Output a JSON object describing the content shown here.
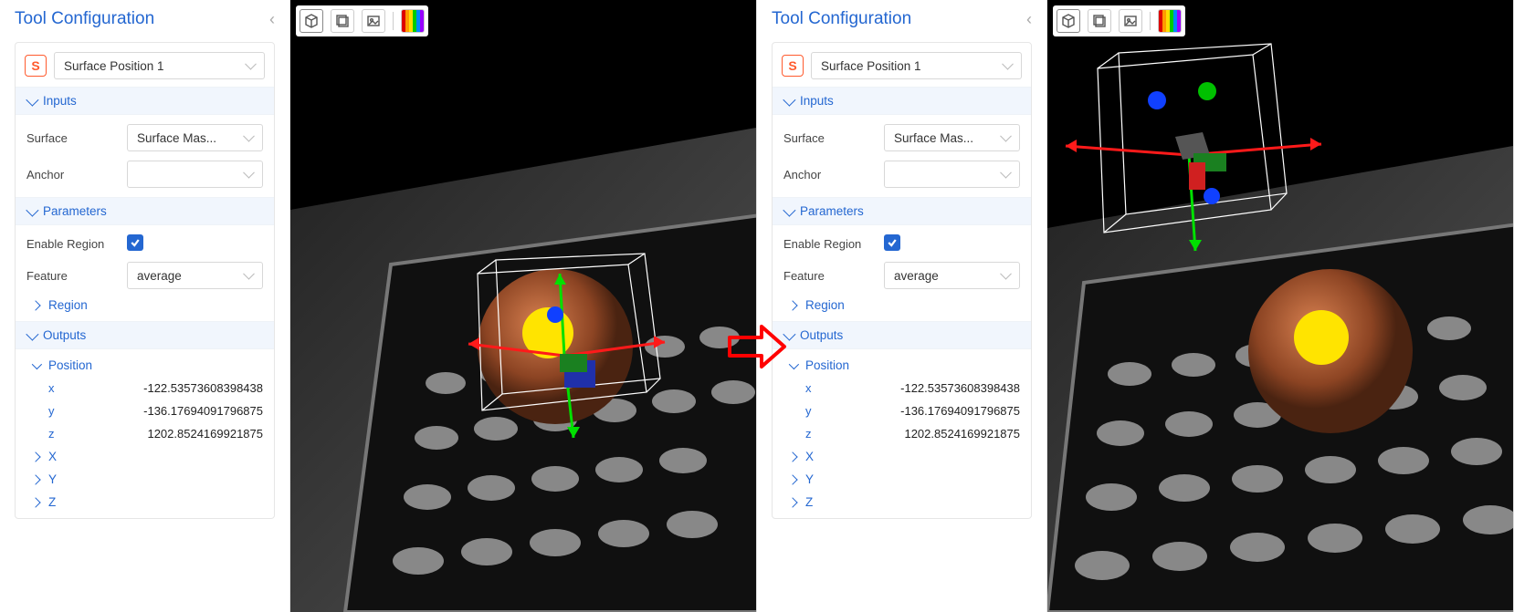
{
  "panel_title": "Tool Configuration",
  "tool_badge": "S",
  "tool_name": "Surface Position 1",
  "sections": {
    "inputs": {
      "header": "Inputs",
      "surface": {
        "label": "Surface",
        "value": "Surface Mas..."
      },
      "anchor": {
        "label": "Anchor",
        "value": ""
      }
    },
    "parameters": {
      "header": "Parameters",
      "enable_region": {
        "label": "Enable Region",
        "checked": true
      },
      "feature": {
        "label": "Feature",
        "value": "average"
      },
      "region_link": "Region"
    },
    "outputs": {
      "header": "Outputs",
      "position": {
        "header": "Position",
        "x": {
          "label": "x",
          "value": "-122.53573608398438"
        },
        "y": {
          "label": "y",
          "value": "-136.17694091796875"
        },
        "z": {
          "label": "z",
          "value": "1202.8524169921875"
        }
      },
      "X_link": "X",
      "Y_link": "Y",
      "Z_link": "Z"
    }
  }
}
